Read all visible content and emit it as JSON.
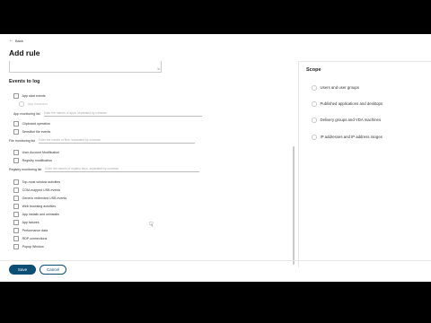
{
  "nav": {
    "back_label": "Back"
  },
  "page": {
    "title": "Add rule"
  },
  "events": {
    "section_title": "Events to log",
    "app_start": "App start events",
    "app_start_sub": "App instances",
    "app_monitoring_label": "App monitoring list",
    "app_monitoring_placeholder": "Enter the names of apps, separated by commas",
    "clipboard": "Clipboard operation",
    "sensitive_file": "Sensitive file events",
    "file_monitoring_label": "File monitoring list",
    "file_monitoring_placeholder": "Enter the names of files, separated by commas",
    "user_account": "User Account Modification",
    "registry": "Registry modification",
    "registry_monitoring_label": "Registry monitoring list",
    "registry_monitoring_placeholder": "Enter the names of registry keys, separated by commas",
    "top_window": "Top-most window activities",
    "com_usb": "COM-mapped USB events",
    "generic_usb": "Generic redirected USB events",
    "web_browsing": "Web browsing activities",
    "app_installs": "App installs and uninstalls",
    "app_failures": "App failures",
    "perf_data": "Performance data",
    "rdp": "RDP connections",
    "popup": "Popup Window"
  },
  "scope": {
    "title": "Scope",
    "items": [
      "Users and user groups",
      "Published applications and desktops",
      "Delivery groups and VDA machines",
      "IP addresses and IP address ranges"
    ]
  },
  "footer": {
    "save_label": "Save",
    "cancel_label": "Cancel"
  }
}
